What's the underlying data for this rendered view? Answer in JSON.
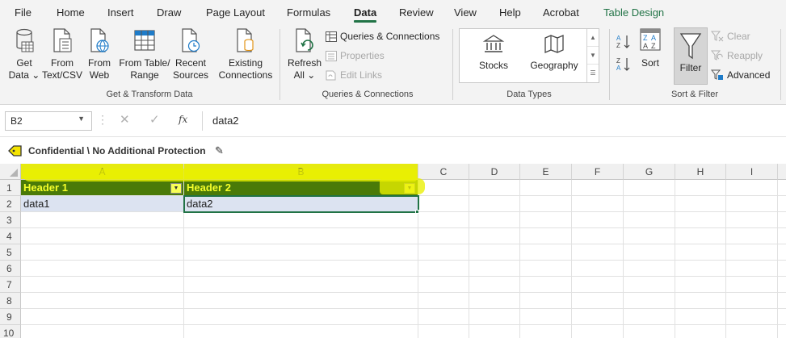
{
  "ribbon_tabs": [
    "File",
    "Home",
    "Insert",
    "Draw",
    "Page Layout",
    "Formulas",
    "Data",
    "Review",
    "View",
    "Help",
    "Acrobat",
    "Table Design"
  ],
  "active_tab": "Data",
  "get_transform": {
    "get_data": "Get Data",
    "get_data_l1": "Get",
    "get_data_l2": "Data ⌄",
    "from_text_l1": "From",
    "from_text_l2": "Text/CSV",
    "from_web_l1": "From",
    "from_web_l2": "Web",
    "from_table_l1": "From Table/",
    "from_table_l2": "Range",
    "recent_l1": "Recent",
    "recent_l2": "Sources",
    "existing_l1": "Existing",
    "existing_l2": "Connections",
    "label": "Get & Transform Data"
  },
  "queries": {
    "refresh_l1": "Refresh",
    "refresh_l2": "All ⌄",
    "queries_connections": "Queries & Connections",
    "properties": "Properties",
    "edit_links": "Edit Links",
    "label": "Queries & Connections"
  },
  "data_types": {
    "stocks": "Stocks",
    "geography": "Geography",
    "label": "Data Types"
  },
  "sort_filter": {
    "sort": "Sort",
    "filter": "Filter",
    "clear": "Clear",
    "reapply": "Reapply",
    "advanced": "Advanced",
    "label": "Sort & Filter"
  },
  "formula_bar": {
    "name_box": "B2",
    "value": "data2"
  },
  "sensitivity": {
    "label": "Confidential \\ No Additional Protection"
  },
  "grid": {
    "columns": [
      "A",
      "B",
      "C",
      "D",
      "E",
      "F",
      "G",
      "H",
      "I"
    ],
    "rows": [
      "1",
      "2",
      "3",
      "4",
      "5",
      "6",
      "7",
      "8",
      "9",
      "10"
    ],
    "header_row": [
      "Header 1",
      "Header 2"
    ],
    "data_row": [
      "data1",
      "data2"
    ]
  },
  "colors": {
    "accent": "#217346",
    "table_header": "#4a7a08",
    "table_header_text": "#f6ff2a",
    "highlight": "#e9f000",
    "table_row": "#dce3f1"
  }
}
